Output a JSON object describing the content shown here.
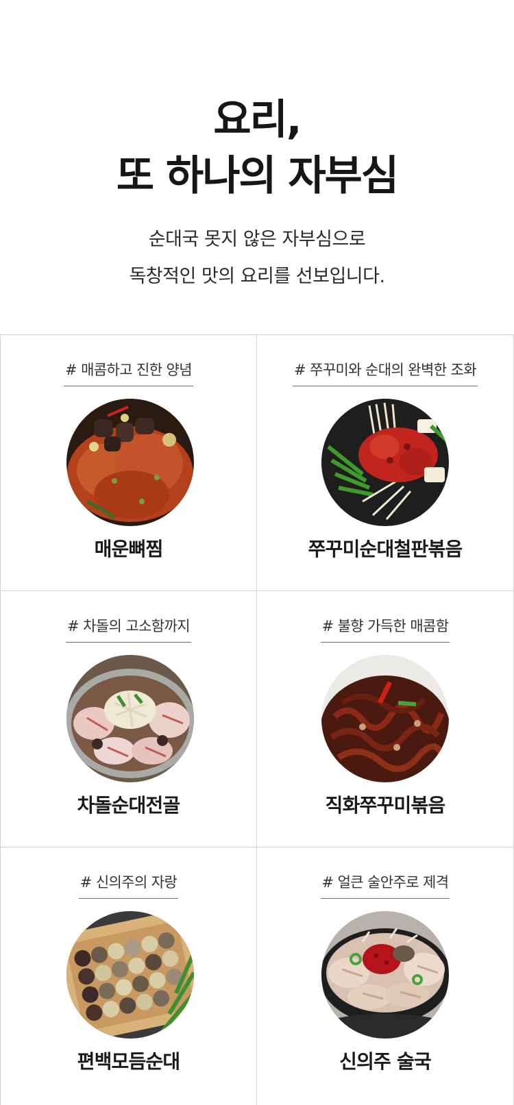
{
  "hero": {
    "title_line1": "요리,",
    "title_line2": "또 하나의 자부심",
    "subtitle_line1": "순대국 못지 않은 자부심으로",
    "subtitle_line2": "독창적인 맛의 요리를 선보입니다."
  },
  "menu": [
    {
      "tag": "# 매콤하고 진한 양념",
      "name": "매운뼈찜",
      "photo_icon": "spicy-braised-pork-bone-photo"
    },
    {
      "tag": "# 쭈꾸미와 순대의 완벽한 조화",
      "name": "쭈꾸미순대철판볶음",
      "photo_icon": "webfoot-octopus-sundae-iron-plate-photo"
    },
    {
      "tag": "# 차돌의 고소함까지",
      "name": "차돌순대전골",
      "photo_icon": "brisket-sundae-hotpot-photo"
    },
    {
      "tag": "# 불향 가득한 매콤함",
      "name": "직화쭈꾸미볶음",
      "photo_icon": "flame-grilled-octopus-photo"
    },
    {
      "tag": "# 신의주의 자랑",
      "name": "편백모듬순대",
      "photo_icon": "cypress-assorted-sundae-photo"
    },
    {
      "tag": "# 얼큰 술안주로 제격",
      "name": "신의주 술국",
      "photo_icon": "sinuiju-hangover-soup-photo"
    }
  ]
}
